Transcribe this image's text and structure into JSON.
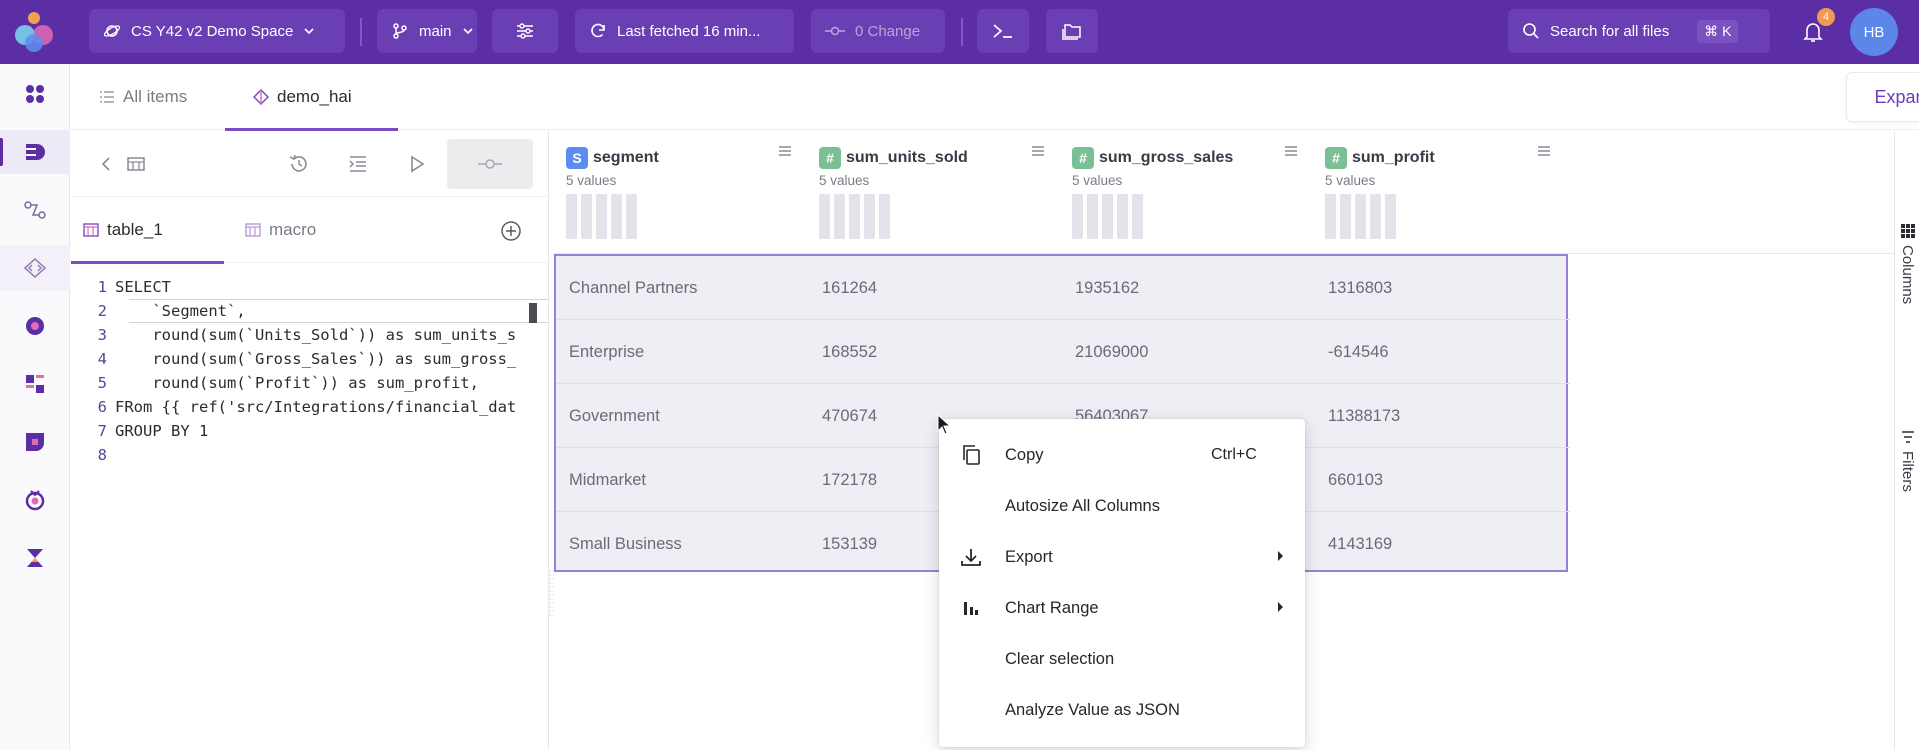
{
  "topbar": {
    "workspace_label": "CS Y42 v2 Demo Space",
    "branch_label": "main",
    "fetch_label": "Last fetched 16 min...",
    "changes_label": "0 Change",
    "search_label": "Search for all files",
    "search_shortcut": "⌘ K",
    "notifications_count": "4",
    "avatar_initials": "HB"
  },
  "page_tabs": {
    "all_items": "All items",
    "active_tab": "demo_hai",
    "expand_label": "Expand"
  },
  "editor": {
    "file_tabs": [
      "table_1",
      "macro"
    ],
    "code_lines": [
      {
        "n": "1",
        "text": "SELECT"
      },
      {
        "n": "2",
        "text": "    `Segment`,"
      },
      {
        "n": "3",
        "text": "    round(sum(`Units_Sold`)) as sum_units_s"
      },
      {
        "n": "4",
        "text": "    round(sum(`Gross_Sales`)) as sum_gross_"
      },
      {
        "n": "5",
        "text": "    round(sum(`Profit`)) as sum_profit,"
      },
      {
        "n": "6",
        "text": "FRom {{ ref('src/Integrations/financial_dat"
      },
      {
        "n": "7",
        "text": "GROUP BY 1"
      },
      {
        "n": "8",
        "text": ""
      }
    ]
  },
  "grid": {
    "columns": [
      {
        "name": "segment",
        "type": "S",
        "type_color": "#5b8def",
        "subtitle": "5 values"
      },
      {
        "name": "sum_units_sold",
        "type": "#",
        "type_color": "#7bbf95",
        "subtitle": "5 values"
      },
      {
        "name": "sum_gross_sales",
        "type": "#",
        "type_color": "#7bbf95",
        "subtitle": "5 values"
      },
      {
        "name": "sum_profit",
        "type": "#",
        "type_color": "#7bbf95",
        "subtitle": "5 values"
      }
    ],
    "rows": [
      [
        "Channel Partners",
        "161264",
        "1935162",
        "1316803"
      ],
      [
        "Enterprise",
        "168552",
        "21069000",
        "-614546"
      ],
      [
        "Government",
        "470674",
        "56403067",
        "11388173"
      ],
      [
        "Midmarket",
        "172178",
        "",
        "660103"
      ],
      [
        "Small Business",
        "153139",
        "",
        "4143169"
      ]
    ],
    "side_labels": [
      "Columns",
      "Filters"
    ]
  },
  "context_menu": {
    "items": [
      {
        "label": "Copy",
        "shortcut": "Ctrl+C",
        "icon": "copy-icon"
      },
      {
        "label": "Autosize All Columns",
        "shortcut": "",
        "icon": ""
      },
      {
        "label": "Export",
        "shortcut": "",
        "icon": "download-icon",
        "submenu": true
      },
      {
        "label": "Chart Range",
        "shortcut": "",
        "icon": "bar-chart-icon",
        "submenu": true
      },
      {
        "label": "Clear selection",
        "shortcut": "",
        "icon": ""
      },
      {
        "label": "Analyze Value as JSON",
        "shortcut": "",
        "icon": ""
      }
    ]
  },
  "colors": {
    "brand": "#5b2ea6",
    "accent": "#7a4cc4",
    "selection": "#9a80d4"
  }
}
